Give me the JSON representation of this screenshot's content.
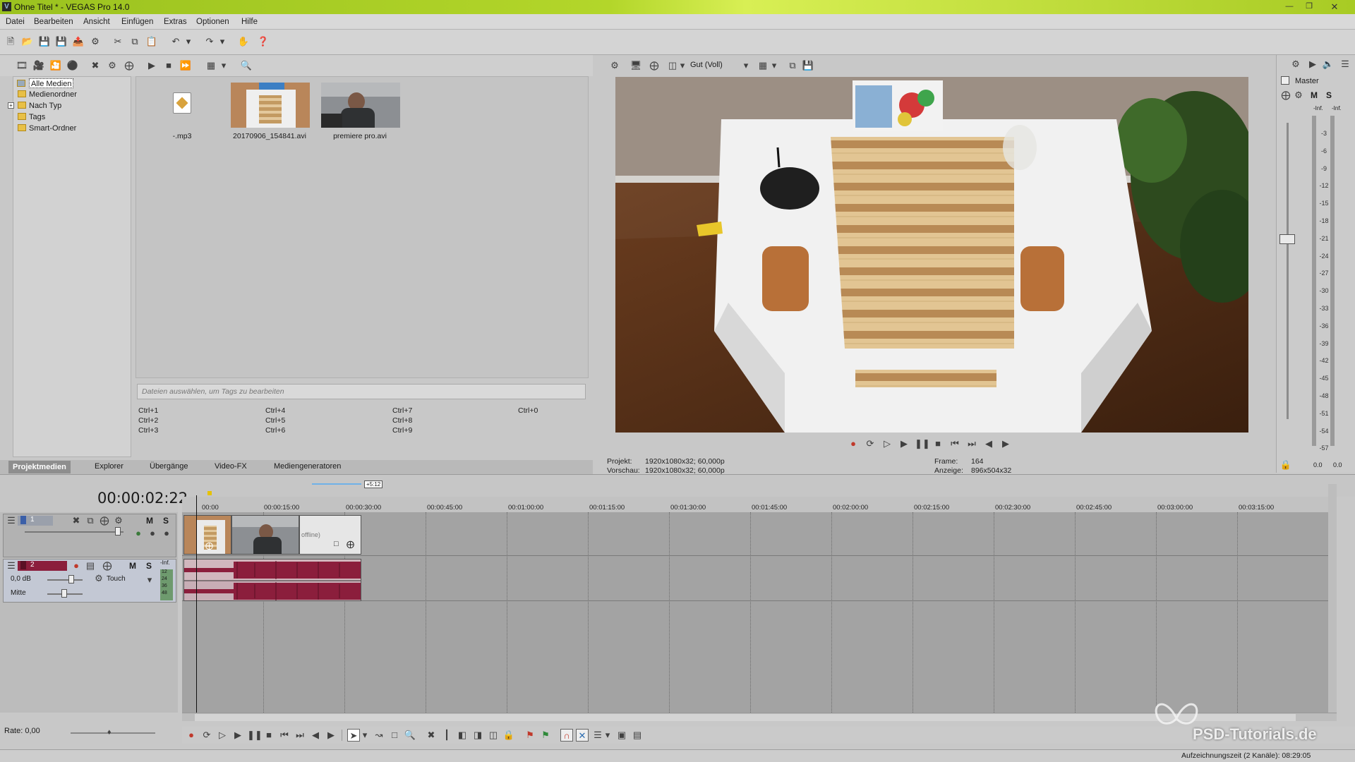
{
  "window": {
    "title": "Ohne Titel * - VEGAS Pro 14.0",
    "logo_letter": "V"
  },
  "menu": [
    "Datei",
    "Bearbeiten",
    "Ansicht",
    "Einfügen",
    "Extras",
    "Optionen",
    "Hilfe"
  ],
  "media": {
    "tree": [
      {
        "label": "Alle Medien",
        "selected": true
      },
      {
        "label": "Medienordner"
      },
      {
        "label": "Nach Typ"
      },
      {
        "label": "Tags"
      },
      {
        "label": "Smart-Ordner"
      }
    ],
    "items": [
      {
        "label": "-.mp3"
      },
      {
        "label": "20170906_154841.avi"
      },
      {
        "label": "premiere pro.avi"
      }
    ],
    "tags_placeholder": "Dateien auswählen, um Tags zu bearbeiten",
    "shortcuts": [
      "Ctrl+1",
      "Ctrl+2",
      "Ctrl+3",
      "Ctrl+4",
      "Ctrl+5",
      "Ctrl+6",
      "Ctrl+7",
      "Ctrl+8",
      "Ctrl+9",
      "Ctrl+0"
    ]
  },
  "tabs": [
    "Projektmedien",
    "Explorer",
    "Übergänge",
    "Video-FX",
    "Mediengeneratoren"
  ],
  "preview": {
    "quality": "Gut (Voll)",
    "projekt_label": "Projekt:",
    "projekt_value": "1920x1080x32; 60,000p",
    "vorschau_label": "Vorschau:",
    "vorschau_value": "1920x1080x32; 60,000p",
    "frame_label": "Frame:",
    "frame_value": "164",
    "anzeige_label": "Anzeige:",
    "anzeige_value": "896x504x32"
  },
  "master": {
    "label": "Master",
    "m": "M",
    "s": "S",
    "inf_left": "-Inf.",
    "inf_right": "-Inf.",
    "db_marks": [
      "3",
      "6",
      "9",
      "12",
      "15",
      "18",
      "21",
      "24",
      "27",
      "30",
      "33",
      "36",
      "39",
      "42",
      "45",
      "48",
      "51",
      "54",
      "57"
    ],
    "bottom_left": "0.0",
    "bottom_right": "0.0"
  },
  "timeline": {
    "timecode": "00:00:02:22",
    "loop_badge": "+5:12",
    "ruler": [
      "00:00",
      "00:00:15:00",
      "00:00:30:00",
      "00:00:45:00",
      "00:01:00:00",
      "00:01:15:00",
      "00:01:30:00",
      "00:01:45:00",
      "00:02:00:00",
      "00:02:15:00",
      "00:02:30:00",
      "00:02:45:00",
      "00:03:00:00",
      "00:03:15:00"
    ],
    "video_track": {
      "number": "1",
      "m": "M",
      "s": "S"
    },
    "audio_track": {
      "number": "2",
      "m": "M",
      "s": "S",
      "volume": "0,0 dB",
      "pan": "Mitte",
      "mode": "Touch",
      "inf": "-Inf.",
      "meter": [
        "12",
        "24",
        "36",
        "48"
      ]
    },
    "offline_label": "offline)",
    "rate": "Rate: 0,00"
  },
  "status": {
    "text": "Aufzeichnungszeit (2 Kanäle): 08:29:05"
  },
  "watermark": "PSD-Tutorials.de",
  "colors": {
    "title_green": "#9bc21f",
    "audio_wave": "#8b1e3c",
    "audio_head": "#8b1e3c"
  }
}
